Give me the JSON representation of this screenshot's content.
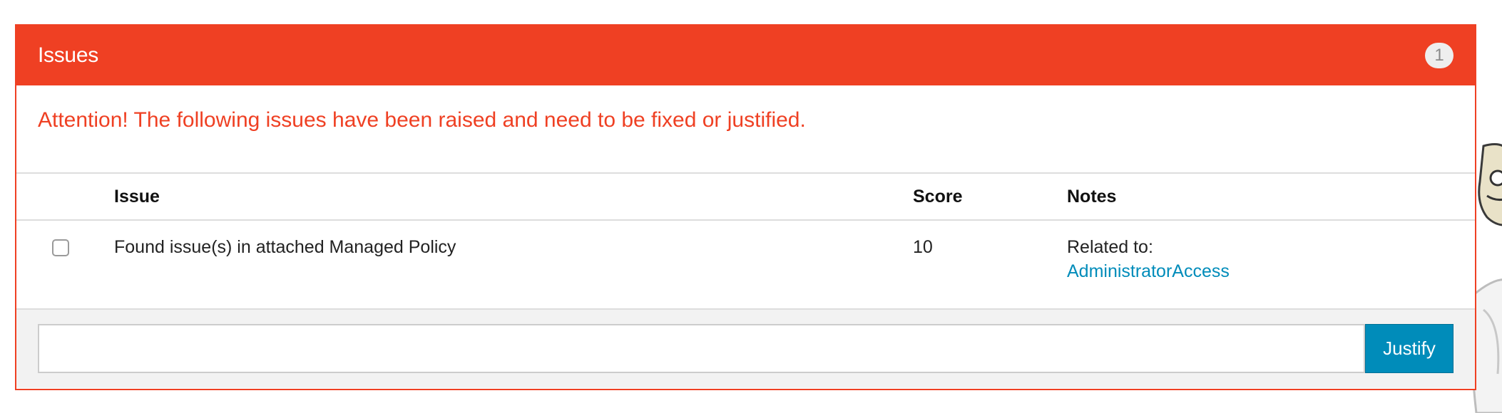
{
  "panel": {
    "title": "Issues",
    "count_badge": "1",
    "accent_color": "#ef4023",
    "attention_message": "Attention! The following issues have been raised and need to be fixed or justified."
  },
  "table": {
    "columns": [
      "",
      "Issue",
      "Score",
      "Notes"
    ],
    "rows": [
      {
        "checked": false,
        "issue": "Found issue(s) in attached Managed Policy",
        "score": "10",
        "notes_label": "Related to:",
        "notes_link": "AdministratorAccess"
      }
    ]
  },
  "footer": {
    "input_value": "",
    "input_placeholder": "",
    "justify_label": "Justify",
    "button_color": "#008cba"
  }
}
